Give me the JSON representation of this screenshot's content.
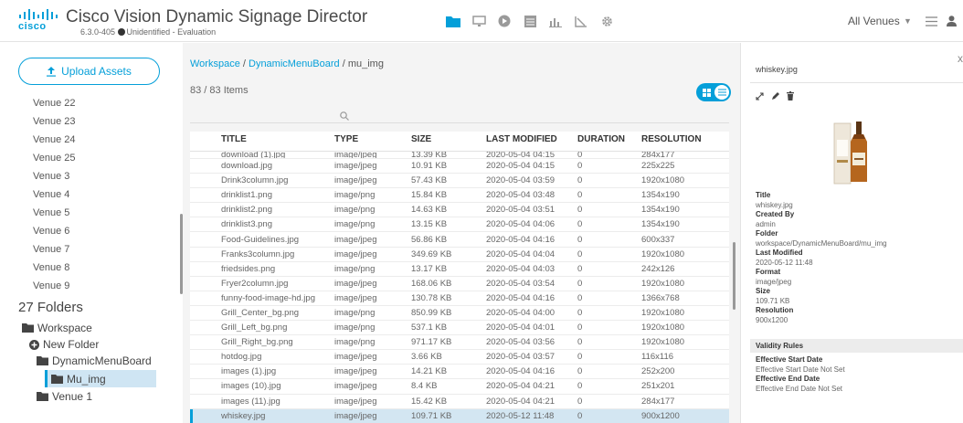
{
  "header": {
    "logo_text": "cisco",
    "title": "Cisco Vision Dynamic Signage Director",
    "version": "6.3.0-405",
    "license": "Unidentified - Evaluation",
    "venue_selected": "All Venues",
    "nav_icons": [
      "folder-icon",
      "monitor-icon",
      "play-icon",
      "list-icon",
      "bar-chart-icon",
      "trigger-icon",
      "gear-icon"
    ],
    "accent_color": "#049fd9"
  },
  "sidebar": {
    "upload_label": "Upload Assets",
    "venues": [
      "Venue 22",
      "Venue 23",
      "Venue 24",
      "Venue 25",
      "Venue 3",
      "Venue 4",
      "Venue 5",
      "Venue 6",
      "Venue 7",
      "Venue 8",
      "Venue 9"
    ],
    "folders_title": "27 Folders",
    "tree": {
      "workspace": "Workspace",
      "new_folder": "New Folder",
      "dynamic_menu_board": "DynamicMenuBoard",
      "mu_img": "Mu_img",
      "venue1": "Venue 1"
    }
  },
  "main": {
    "breadcrumb": {
      "workspace": "Workspace",
      "sep1": " / ",
      "board": "DynamicMenuBoard",
      "sep2": " /  ",
      "current": "mu_img"
    },
    "count": "83 / 83 Items",
    "search_placeholder": "",
    "columns": [
      "TITLE",
      "TYPE",
      "SIZE",
      "LAST MODIFIED",
      "DURATION",
      "RESOLUTION"
    ],
    "partial_row": [
      "download (1).jpg",
      "image/jpeg",
      "13.39 KB",
      "2020-05-04 04:15",
      "0",
      "284x177"
    ],
    "rows": [
      [
        "download.jpg",
        "image/jpeg",
        "10.91 KB",
        "2020-05-04 04:15",
        "0",
        "225x225"
      ],
      [
        "Drink3column.jpg",
        "image/jpeg",
        "57.43 KB",
        "2020-05-04 03:59",
        "0",
        "1920x1080"
      ],
      [
        "drinklist1.png",
        "image/png",
        "15.84 KB",
        "2020-05-04 03:48",
        "0",
        "1354x190"
      ],
      [
        "drinklist2.png",
        "image/png",
        "14.63 KB",
        "2020-05-04 03:51",
        "0",
        "1354x190"
      ],
      [
        "drinklist3.png",
        "image/png",
        "13.15 KB",
        "2020-05-04 04:06",
        "0",
        "1354x190"
      ],
      [
        "Food-Guidelines.jpg",
        "image/jpeg",
        "56.86 KB",
        "2020-05-04 04:16",
        "0",
        "600x337"
      ],
      [
        "Franks3column.jpg",
        "image/jpeg",
        "349.69 KB",
        "2020-05-04 04:04",
        "0",
        "1920x1080"
      ],
      [
        "friedsides.png",
        "image/png",
        "13.17 KB",
        "2020-05-04 04:03",
        "0",
        "242x126"
      ],
      [
        "Fryer2column.jpg",
        "image/jpeg",
        "168.06 KB",
        "2020-05-04 03:54",
        "0",
        "1920x1080"
      ],
      [
        "funny-food-image-hd.jpg",
        "image/jpeg",
        "130.78 KB",
        "2020-05-04 04:16",
        "0",
        "1366x768"
      ],
      [
        "Grill_Center_bg.png",
        "image/png",
        "850.99 KB",
        "2020-05-04 04:00",
        "0",
        "1920x1080"
      ],
      [
        "Grill_Left_bg.png",
        "image/png",
        "537.1 KB",
        "2020-05-04 04:01",
        "0",
        "1920x1080"
      ],
      [
        "Grill_Right_bg.png",
        "image/png",
        "971.17 KB",
        "2020-05-04 03:56",
        "0",
        "1920x1080"
      ],
      [
        "hotdog.jpg",
        "image/jpeg",
        "3.66 KB",
        "2020-05-04 03:57",
        "0",
        "116x116"
      ],
      [
        "images (1).jpg",
        "image/jpeg",
        "14.21 KB",
        "2020-05-04 04:16",
        "0",
        "252x200"
      ],
      [
        "images (10).jpg",
        "image/jpeg",
        "8.4 KB",
        "2020-05-04 04:21",
        "0",
        "251x201"
      ],
      [
        "images (11).jpg",
        "image/jpeg",
        "15.42 KB",
        "2020-05-04 04:21",
        "0",
        "284x177"
      ],
      [
        "whiskey.jpg",
        "image/jpeg",
        "109.71 KB",
        "2020-05-12 11:48",
        "0",
        "900x1200"
      ]
    ],
    "selected_row": 17
  },
  "panel": {
    "filename": "whiskey.jpg",
    "meta": [
      {
        "label": "Title",
        "value": "whiskey.jpg"
      },
      {
        "label": "Created By",
        "value": "admin"
      },
      {
        "label": "Folder",
        "value": "workspace/DynamicMenuBoard/mu_img"
      },
      {
        "label": "Last Modified",
        "value": "2020-05-12 11:48"
      },
      {
        "label": "Format",
        "value": "image/jpeg"
      },
      {
        "label": "Size",
        "value": "109.71 KB"
      },
      {
        "label": "Resolution",
        "value": "900x1200"
      }
    ],
    "validity_title": "Validity Rules",
    "validity": [
      {
        "label": "Effective Start Date",
        "value": "Effective Start Date Not Set"
      },
      {
        "label": "Effective End Date",
        "value": "Effective End Date Not Set"
      }
    ]
  }
}
